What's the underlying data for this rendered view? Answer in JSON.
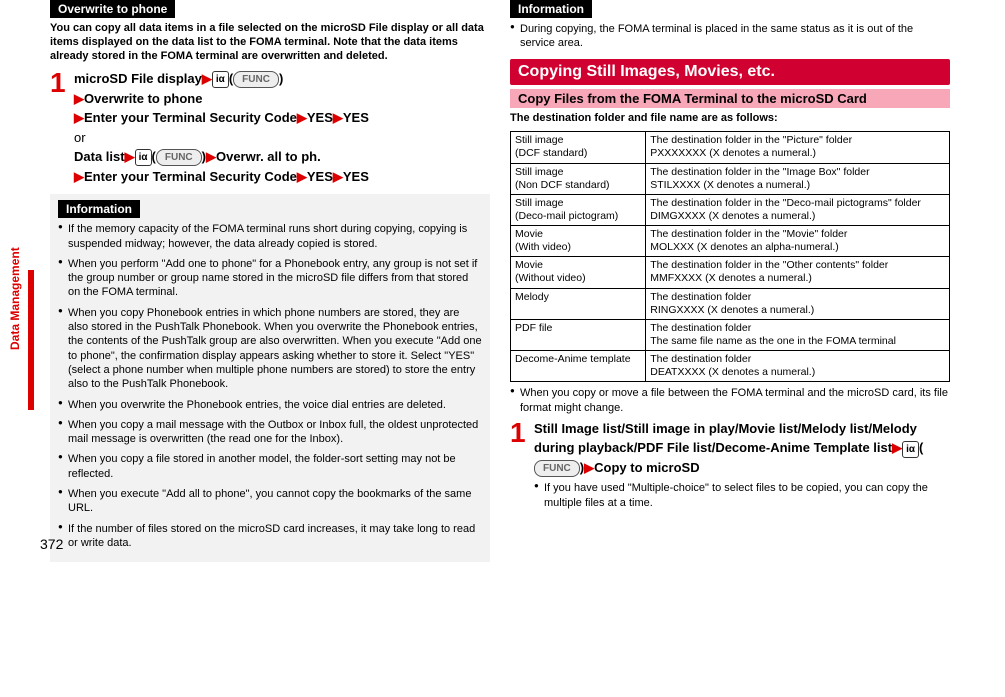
{
  "sidelabel": "Data Management",
  "pagenum": "372",
  "left": {
    "overwrite_title": "Overwrite to phone",
    "intro": "You can copy all data items in a file selected on the microSD File display or all data items displayed on the data list to the FOMA terminal. Note that the data items already stored in the FOMA terminal are overwritten and deleted.",
    "step_no": "1",
    "step_l1a": "microSD File display",
    "func": "FUNC",
    "key": "iα",
    "step_l2": "Overwrite to phone",
    "step_l3a": "Enter your Terminal Security Code",
    "yes": "YES",
    "or": "or",
    "step_l4a": "Data list",
    "step_l4b": "Overwr. all to ph.",
    "info_title": "Information",
    "info": [
      "If the memory capacity of the FOMA terminal runs short during copying, copying is suspended midway; however, the data already copied is stored.",
      "When you perform \"Add one to phone\" for a Phonebook entry, any group is not set if the group number or group name stored in the microSD file differs from that stored on the FOMA terminal.",
      "When you copy Phonebook entries in which phone numbers are stored, they are also stored in the PushTalk Phonebook. When you overwrite the Phonebook entries, the contents of the PushTalk group are also overwritten.\nWhen you execute \"Add one to phone\", the confirmation display appears asking whether to store it. Select \"YES\" (select a phone number when multiple phone numbers are stored) to store the entry also to the PushTalk Phonebook.",
      "When you overwrite the Phonebook entries, the voice dial entries are deleted.",
      "When you copy a mail message with the Outbox or Inbox full, the oldest unprotected mail message is overwritten (the read one for the Inbox).",
      "When you copy a file stored in another model, the folder-sort setting may not be reflected.",
      "When you execute \"Add all to phone\", you cannot copy the bookmarks of the same URL.",
      "If the number of files stored on the microSD card increases, it may take long to read or write data."
    ]
  },
  "right": {
    "info_title": "Information",
    "info_top": "During copying, the FOMA terminal is placed in the same status as it is out of the service area.",
    "heading": "Copying Still Images, Movies, etc.",
    "subheading": "Copy Files from the FOMA Terminal to the microSD Card",
    "intro": "The destination folder and file name are as follows:",
    "table": [
      [
        "Still image\n(DCF standard)",
        "The destination folder in the \"Picture\" folder\nPXXXXXXX (X denotes a numeral.)"
      ],
      [
        "Still image\n(Non DCF standard)",
        "The destination folder in the \"Image Box\" folder\nSTILXXXX (X denotes a numeral.)"
      ],
      [
        "Still image\n(Deco-mail pictogram)",
        "The destination folder in the \"Deco-mail pictograms\" folder\nDIMGXXXX (X denotes a numeral.)"
      ],
      [
        "Movie\n(With video)",
        "The destination folder in the \"Movie\" folder\nMOLXXX (X denotes an alpha-numeral.)"
      ],
      [
        "Movie\n(Without video)",
        "The destination folder in the \"Other contents\" folder\nMMFXXXX (X denotes a numeral.)"
      ],
      [
        "Melody",
        "The destination folder\nRINGXXXX (X denotes a numeral.)"
      ],
      [
        "PDF file",
        "The destination folder\nThe same file name as the one in the FOMA terminal"
      ],
      [
        "Decome-Anime template",
        "The destination folder\nDEATXXXX (X denotes a numeral.)"
      ]
    ],
    "note": "When you copy or move a file between the FOMA terminal and the microSD card, its file format might change.",
    "step_no": "1",
    "step_body": "Still Image list/Still image in play/Movie list/Melody list/Melody during playback/PDF File list/Decome-Anime Template list",
    "step_tail": "Copy to microSD",
    "subnote": "If you have used \"Multiple-choice\" to select files to be copied, you can copy the multiple files at a time."
  }
}
